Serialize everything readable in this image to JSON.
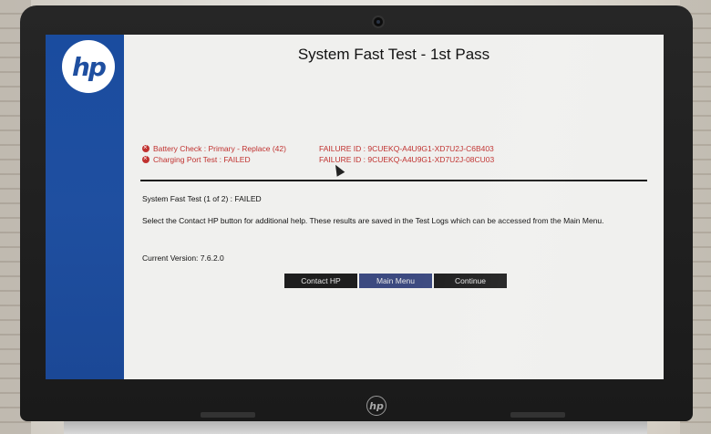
{
  "screen": {
    "title": "System Fast Test - 1st Pass",
    "logo_text": "hp",
    "failures": [
      {
        "label": "Battery Check : Primary - Replace (42)",
        "failure_id": "FAILURE ID : 9CUEKQ-A4U9G1-XD7U2J-C6B403"
      },
      {
        "label": "Charging Port Test : FAILED",
        "failure_id": "FAILURE ID : 9CUEKQ-A4U9G1-XD7U2J-08CU03"
      }
    ],
    "summary": "System Fast Test (1 of 2) : FAILED",
    "help_text": "Select the Contact HP button for additional help. These results are saved in the Test Logs which can be accessed from the Main Menu.",
    "version": "Current Version: 7.6.2.0",
    "buttons": {
      "contact": "Contact HP",
      "menu": "Main Menu",
      "continue": "Continue"
    }
  },
  "bezel": {
    "logo_text": "hp"
  },
  "colors": {
    "side_panel": "#1f4fa0",
    "error_red": "#c0312f",
    "selected_button": "#3c4a80",
    "button": "#1e1e1e"
  },
  "icons": [
    "error-icon",
    "mouse-cursor-icon",
    "webcam-icon"
  ]
}
